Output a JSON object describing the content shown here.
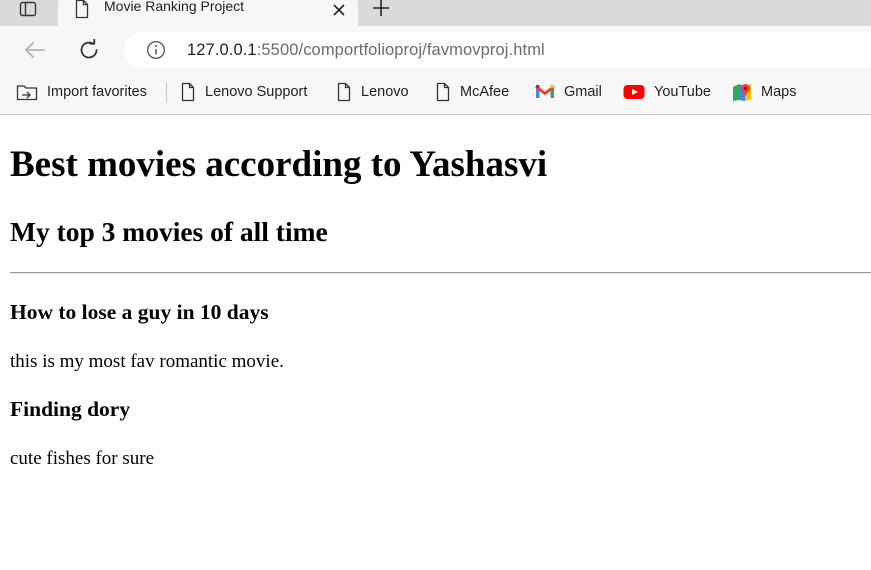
{
  "browser": {
    "tab": {
      "title": "Movie Ranking Project"
    },
    "address": {
      "host": "127.0.0.1",
      "path": ":5500/comportfolioproj/favmovproj.html"
    },
    "bookmarks": [
      {
        "label": "Import favorites",
        "icon": "import-favorites-icon"
      },
      {
        "label": "Lenovo Support",
        "icon": "page-icon"
      },
      {
        "label": "Lenovo",
        "icon": "page-icon"
      },
      {
        "label": "McAfee",
        "icon": "page-icon"
      },
      {
        "label": "Gmail",
        "icon": "gmail-icon"
      },
      {
        "label": "YouTube",
        "icon": "youtube-icon"
      },
      {
        "label": "Maps",
        "icon": "maps-icon"
      }
    ]
  },
  "page": {
    "title": "Best movies according to Yashasvi",
    "subtitle": "My top 3 movies of all time",
    "movies": [
      {
        "name": "How to lose a guy in 10 days",
        "description": "this is my most fav romantic movie."
      },
      {
        "name": "Finding dory",
        "description": "cute fishes for sure"
      }
    ]
  },
  "colors": {
    "youtube_red": "#ff0000",
    "chrome_bg": "#f7f7f7",
    "tabstrip_bg": "#dadada"
  }
}
